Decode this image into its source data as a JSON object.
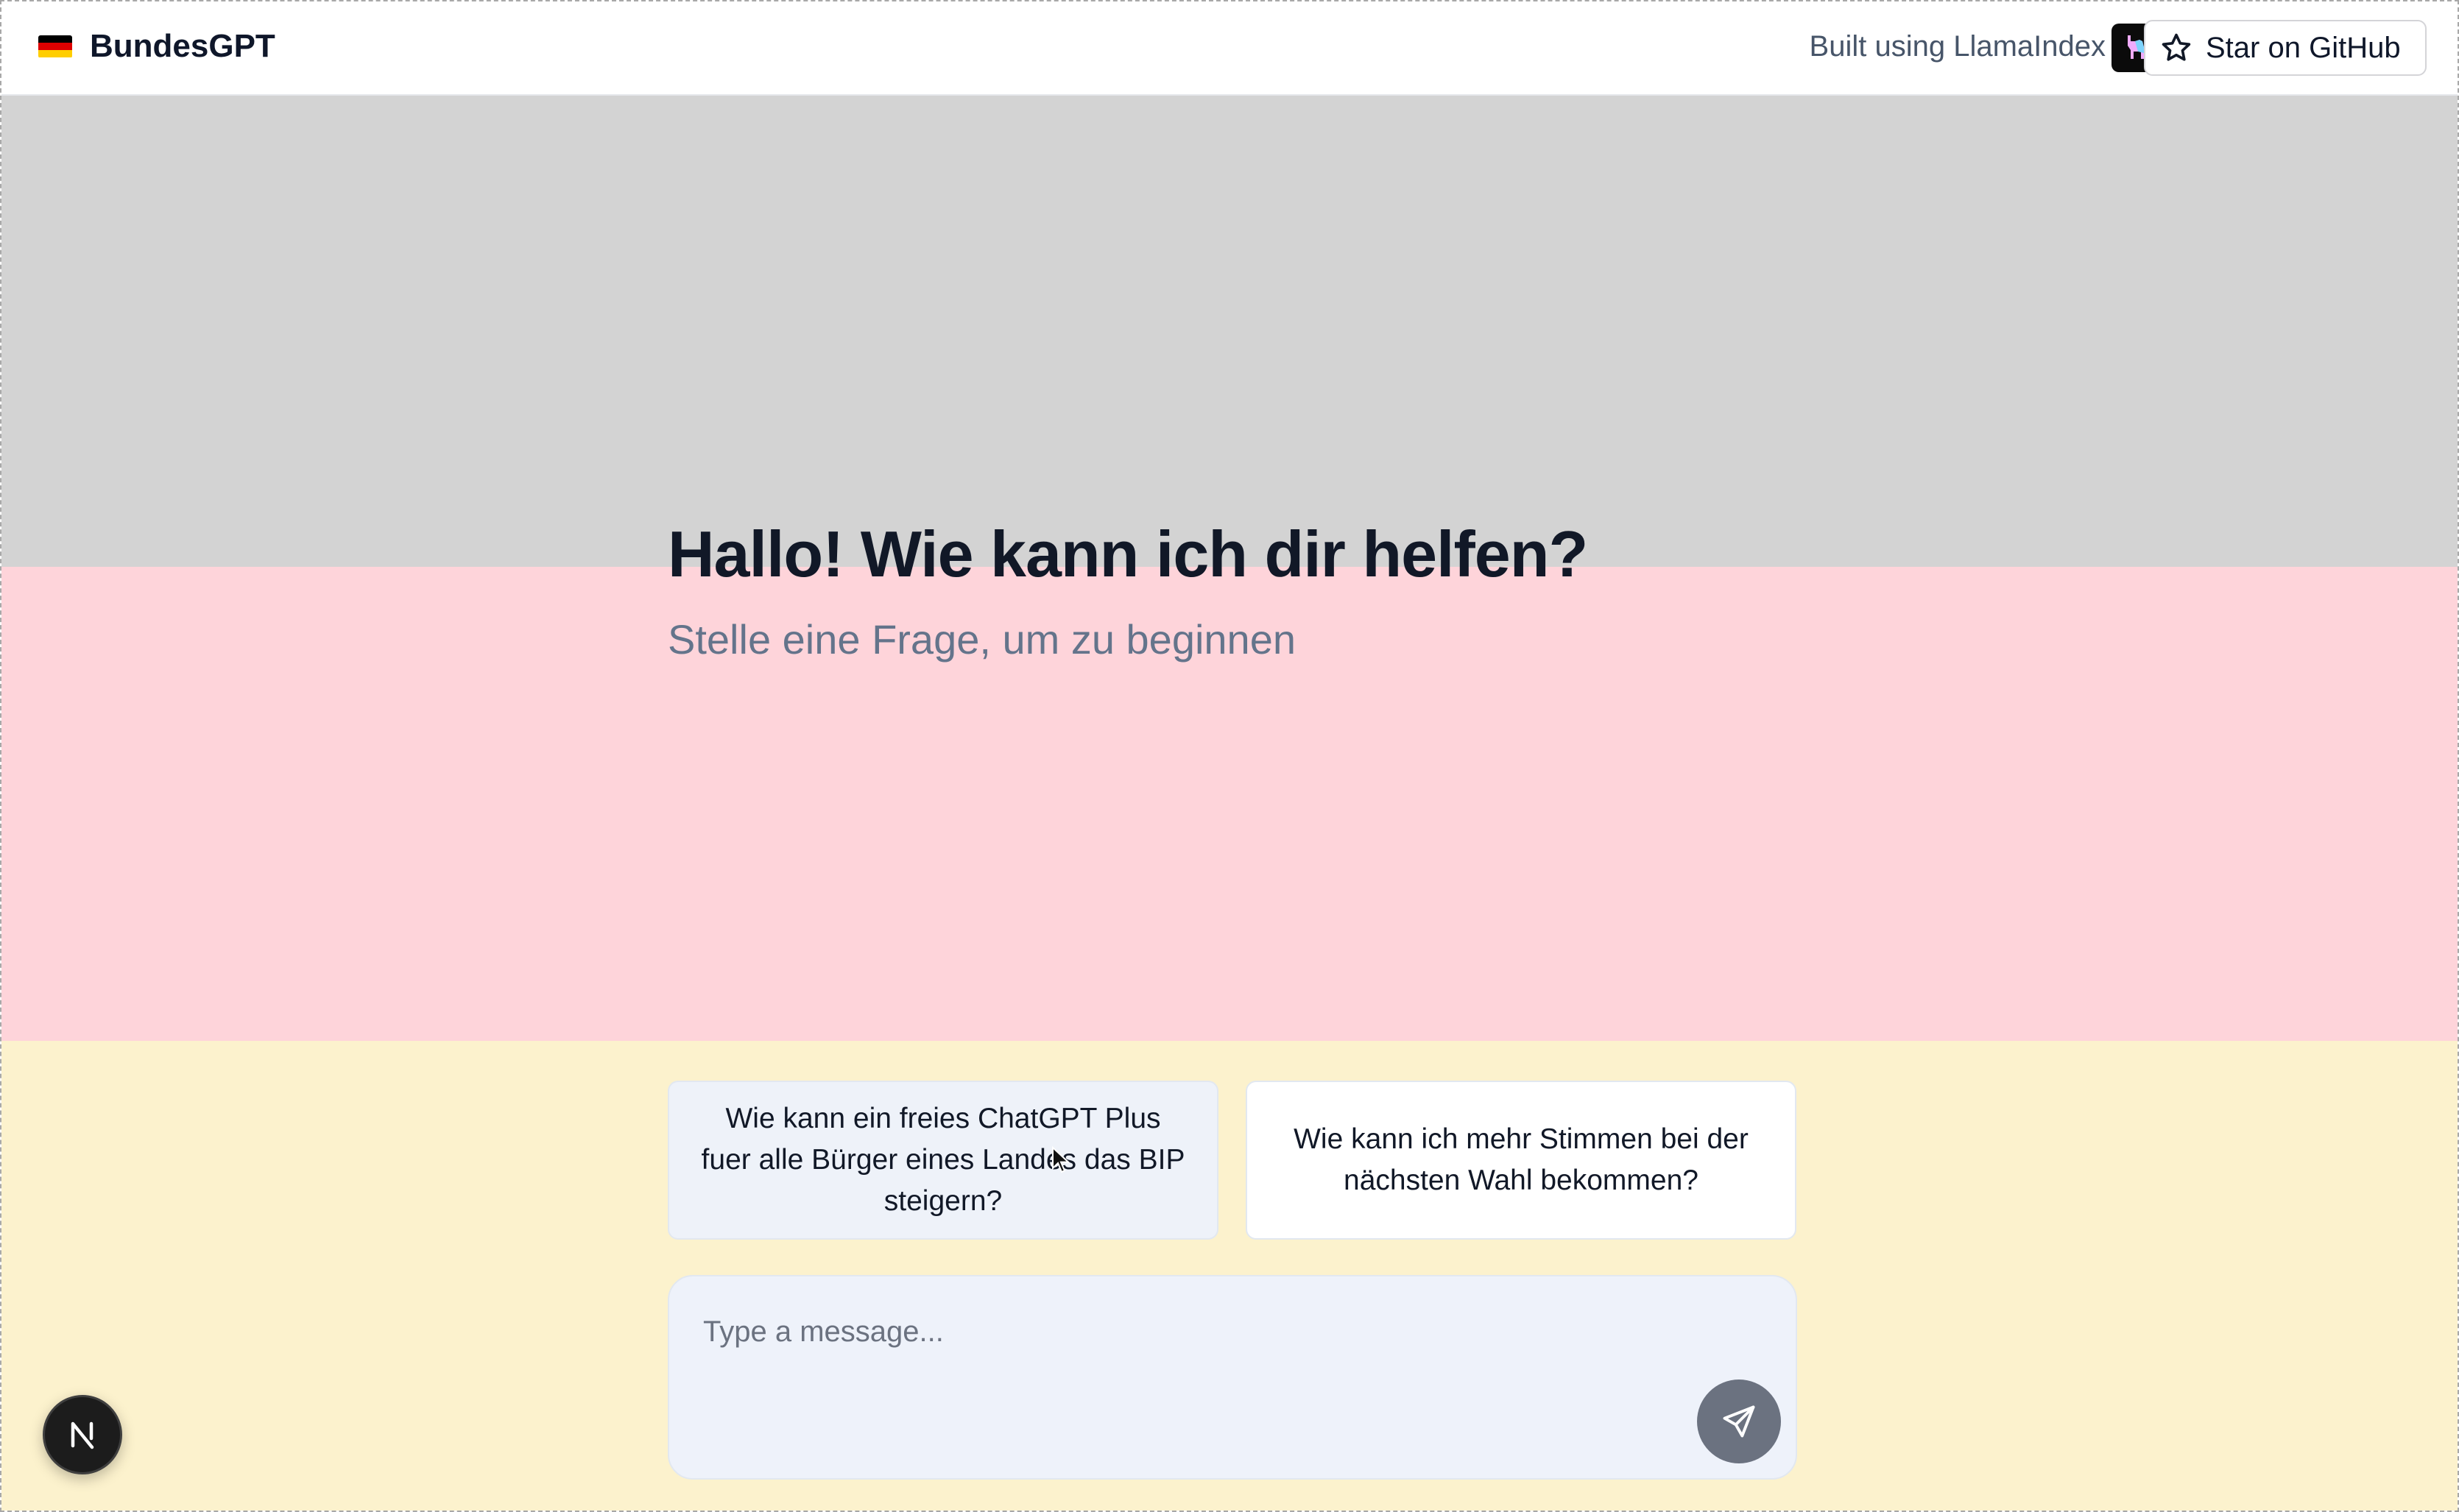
{
  "header": {
    "app_name": "BundesGPT",
    "built_label": "Built using LlamaIndex",
    "star_button_label": "Star on GitHub"
  },
  "hero": {
    "title": "Hallo! Wie kann ich dir helfen?",
    "subtitle": "Stelle eine Frage, um zu beginnen"
  },
  "suggestions": [
    {
      "text": "Wie kann ein freies ChatGPT Plus fuer alle Bürger eines Landes das BIP steigern?"
    },
    {
      "text": "Wie kann ich mehr Stimmen bei der nächsten Wahl bekommen?"
    }
  ],
  "composer": {
    "placeholder": "Type a message...",
    "value": ""
  },
  "icons": {
    "flag": "germany-flag-icon",
    "logo": "llama-logo-icon",
    "star": "star-icon",
    "send": "send-icon",
    "badge": "nextjs-badge-icon"
  },
  "colors": {
    "band_top": "#d3d3d3",
    "band_middle": "#fed4da",
    "band_bottom": "#fcf2cd",
    "send_button": "#6b7280"
  }
}
